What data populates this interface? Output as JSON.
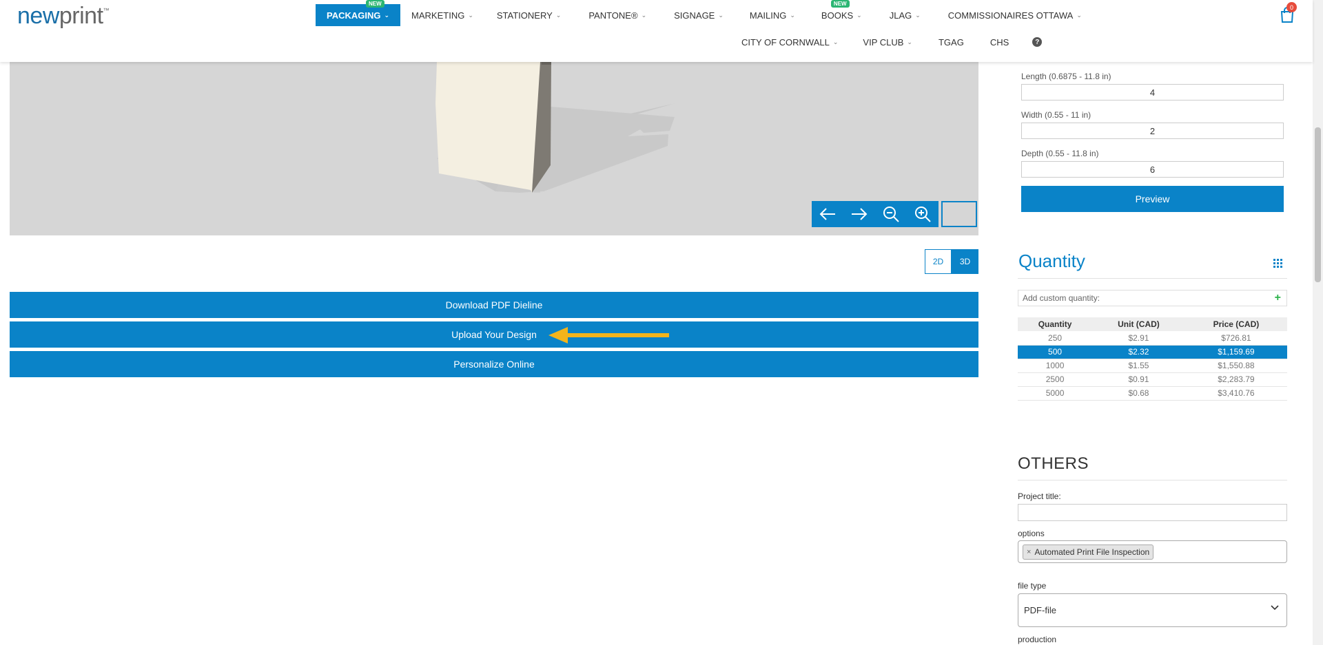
{
  "brand": {
    "logo_new": "new",
    "logo_print": "print",
    "tm": "™"
  },
  "nav": {
    "row1": [
      {
        "label": "PACKAGING",
        "active": true,
        "badge": "NEW"
      },
      {
        "label": "MARKETING"
      },
      {
        "label": "STATIONERY"
      },
      {
        "label": "PANTONE®"
      },
      {
        "label": "SIGNAGE"
      },
      {
        "label": "MAILING"
      },
      {
        "label": "BOOKS",
        "badge": "NEW"
      },
      {
        "label": "JLAG"
      },
      {
        "label": "COMMISSIONAIRES OTTAWA"
      }
    ],
    "row2": [
      {
        "label": "CITY OF CORNWALL",
        "chevron": true
      },
      {
        "label": "VIP CLUB",
        "chevron": true
      },
      {
        "label": "TGAG",
        "chevron": false
      },
      {
        "label": "CHS",
        "chevron": false
      }
    ],
    "help_icon": "question-circle-icon"
  },
  "cart": {
    "count": "0",
    "icon": "shopping-bag-icon"
  },
  "viewer": {
    "controls": [
      "rotate-left-icon",
      "rotate-right-icon",
      "zoom-out-icon",
      "zoom-in-icon"
    ],
    "toggle": {
      "opt2d": "2D",
      "opt3d": "3D",
      "selected": "3D"
    }
  },
  "actions": {
    "download": "Download PDF Dieline",
    "upload": "Upload Your Design",
    "personalize": "Personalize Online"
  },
  "dimensions": {
    "length_label": "Length (0.6875 - 11.8 in)",
    "length_value": "4",
    "width_label": "Width (0.55 - 11 in)",
    "width_value": "2",
    "depth_label": "Depth (0.55 - 11.8 in)",
    "depth_value": "6",
    "preview": "Preview"
  },
  "quantity": {
    "title": "Quantity",
    "custom_placeholder": "Add custom quantity:",
    "headers": [
      "Quantity",
      "Unit (CAD)",
      "Price (CAD)"
    ],
    "rows": [
      [
        "250",
        "$2.91",
        "$726.81"
      ],
      [
        "500",
        "$2.32",
        "$1,159.69"
      ],
      [
        "1000",
        "$1.55",
        "$1,550.88"
      ],
      [
        "2500",
        "$0.91",
        "$2,283.79"
      ],
      [
        "5000",
        "$0.68",
        "$3,410.76"
      ]
    ],
    "selected_row": 1
  },
  "others": {
    "title": "OTHERS",
    "project_title_label": "Project title:",
    "project_title_value": "",
    "options_label": "options",
    "options_tag": "Automated Print File Inspection",
    "file_type_label": "file type",
    "file_type_value": "PDF-file",
    "production_label": "production"
  },
  "colors": {
    "accent": "#0a83c8",
    "badge_green": "#2bb673",
    "arrow": "#f3b41b",
    "cart_badge": "#e74c3c"
  }
}
